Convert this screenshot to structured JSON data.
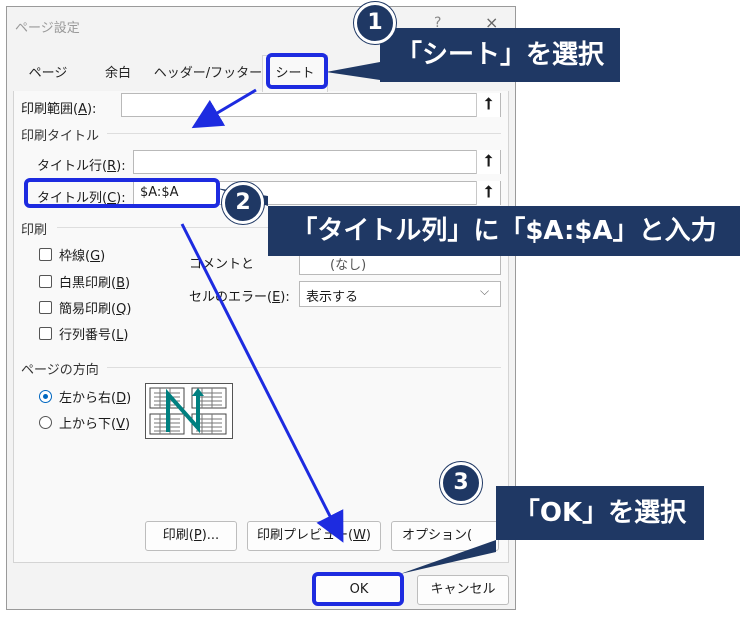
{
  "window": {
    "title": "ページ設定",
    "help": "?",
    "close": "×"
  },
  "tabs": [
    {
      "label": "ページ"
    },
    {
      "label": "余白"
    },
    {
      "label": "ヘッダー/フッター"
    },
    {
      "label": "シート"
    }
  ],
  "print_area": {
    "label": "印刷範囲(",
    "key": "A",
    "suffix": "):",
    "value": ""
  },
  "print_titles": {
    "section": "印刷タイトル",
    "rows_label": "タイトル行(",
    "rows_key": "R",
    "rows_suffix": "):",
    "rows_value": "",
    "cols_label": "タイトル列(",
    "cols_key": "C",
    "cols_suffix": "):",
    "cols_value": "$A:$A"
  },
  "print": {
    "section": "印刷",
    "gridlines": "枠線(",
    "gridlines_key": "G",
    "bw": "白黒印刷(",
    "bw_key": "B",
    "draft": "簡易印刷(",
    "draft_key": "Q",
    "headings": "行列番号(",
    "headings_key": "L",
    "close_paren": ")",
    "comments_label": "コメントと",
    "comments_value": "(なし)",
    "errors_label": "セルのエラー(",
    "errors_key": "E",
    "errors_suffix": "):",
    "errors_value": "表示する"
  },
  "order": {
    "section": "ページの方向",
    "ltr": "左から右(",
    "ltr_key": "D",
    "ttb": "上から下(",
    "ttb_key": "V",
    "close_paren": ")"
  },
  "buttons": {
    "print": "印刷(",
    "print_key": "P",
    "print_suffix": ")...",
    "preview": "印刷プレビュー(",
    "preview_key": "W",
    "preview_suffix": ")",
    "options": "オプション(",
    "ok": "OK",
    "cancel": "キャンセル"
  },
  "icons": {
    "collapse": "⭡",
    "dropdown": "⌵"
  },
  "annotations": {
    "step1_num": "1",
    "step1_text": "「シート」を選択",
    "step2_num": "2",
    "step2_text": "「タイトル列」に「$A:$A」と入力",
    "step3_num": "3",
    "step3_text": "「OK」を選択"
  },
  "colors": {
    "callout_bg": "#1f3864",
    "highlight": "#1d2be0",
    "radio_accent": "#0067c0"
  }
}
